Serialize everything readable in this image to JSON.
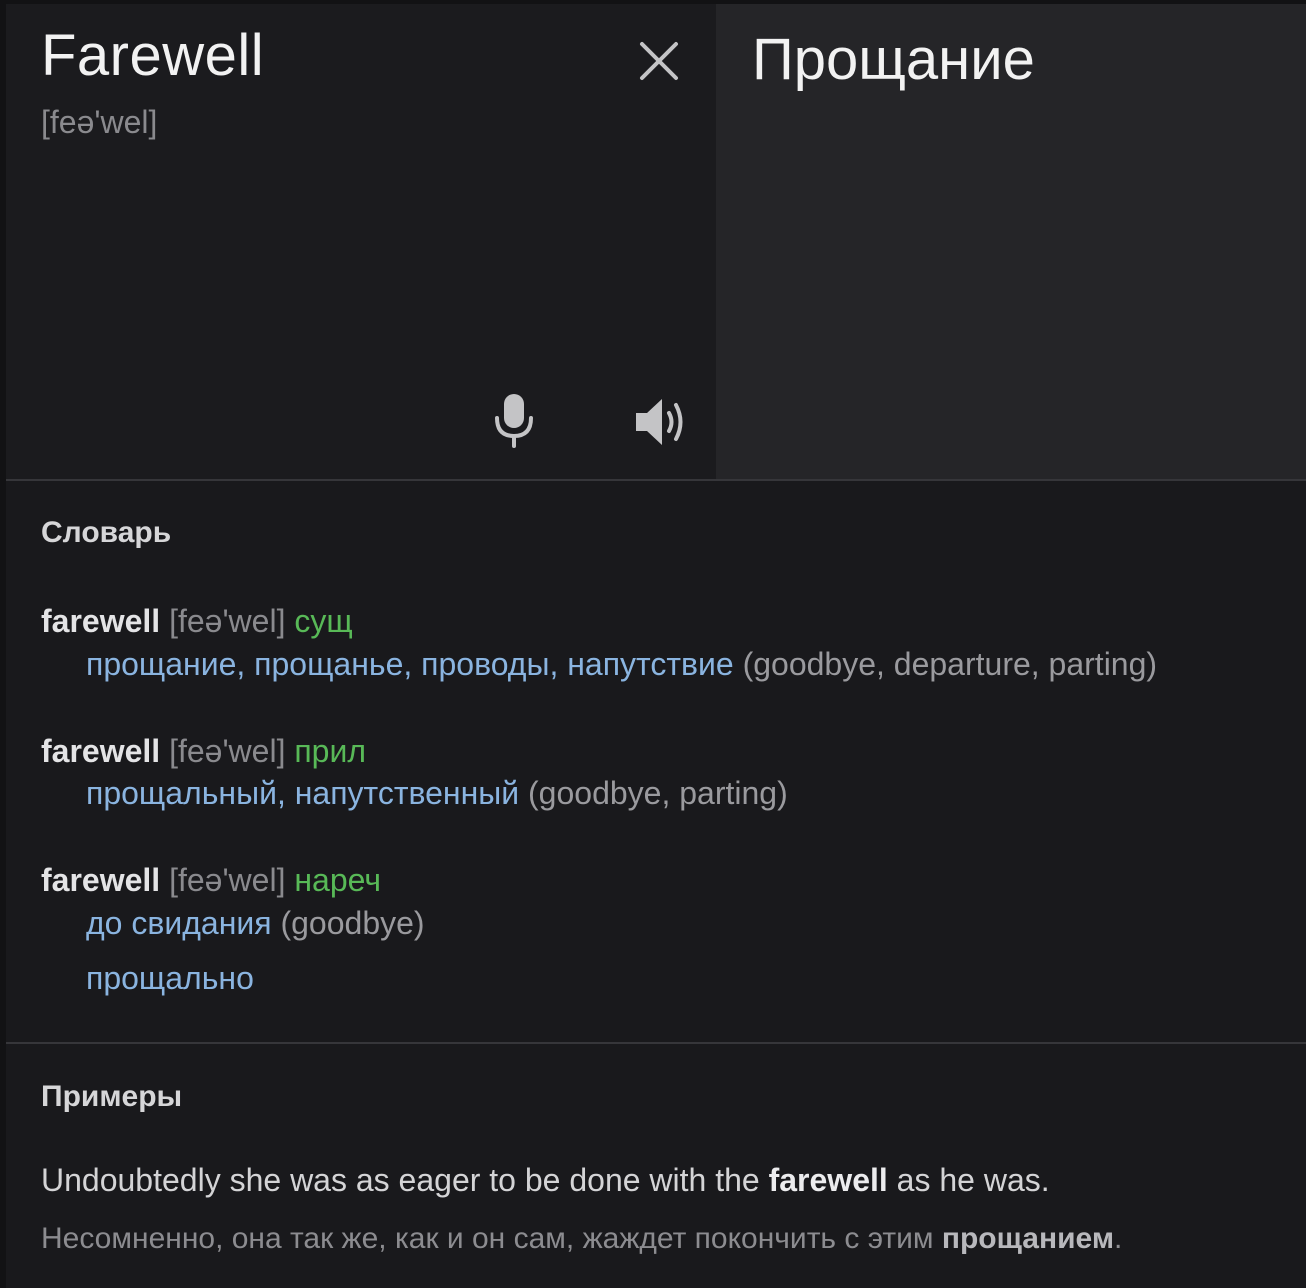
{
  "source": {
    "word": "Farewell",
    "transcription": "[feə'wel]"
  },
  "target": {
    "word": "Прощание"
  },
  "icons": {
    "clear": "close-icon",
    "mic": "microphone-icon",
    "speaker": "speaker-icon"
  },
  "colors": {
    "background": "#19191c",
    "translation_link": "#8ab4e0",
    "part_of_speech": "#58b957"
  },
  "dictionary": {
    "title": "Словарь",
    "entries": [
      {
        "headword": "farewell",
        "transcription": "[feə'wel]",
        "pos": "сущ",
        "lines": [
          {
            "translations": "прощание, прощанье, проводы, напутствие",
            "synonyms": "(goodbye, departure, parting)"
          }
        ]
      },
      {
        "headword": "farewell",
        "transcription": "[feə'wel]",
        "pos": "прил",
        "lines": [
          {
            "translations": "прощальный, напутственный",
            "synonyms": "(goodbye, parting)"
          }
        ]
      },
      {
        "headword": "farewell",
        "transcription": "[feə'wel]",
        "pos": "нареч",
        "lines": [
          {
            "translations": "до свидания",
            "synonyms": "(goodbye)"
          },
          {
            "translations": "прощально",
            "synonyms": ""
          }
        ]
      }
    ]
  },
  "examples": {
    "title": "Примеры",
    "items": [
      {
        "en_before": "Undoubtedly she was as eager to be done with the ",
        "en_bold": "farewell",
        "en_after": " as he was.",
        "ru_before": "Несомненно, она так же, как и он сам, жаждет покончить с этим ",
        "ru_bold": "прощанием",
        "ru_after": "."
      }
    ]
  }
}
